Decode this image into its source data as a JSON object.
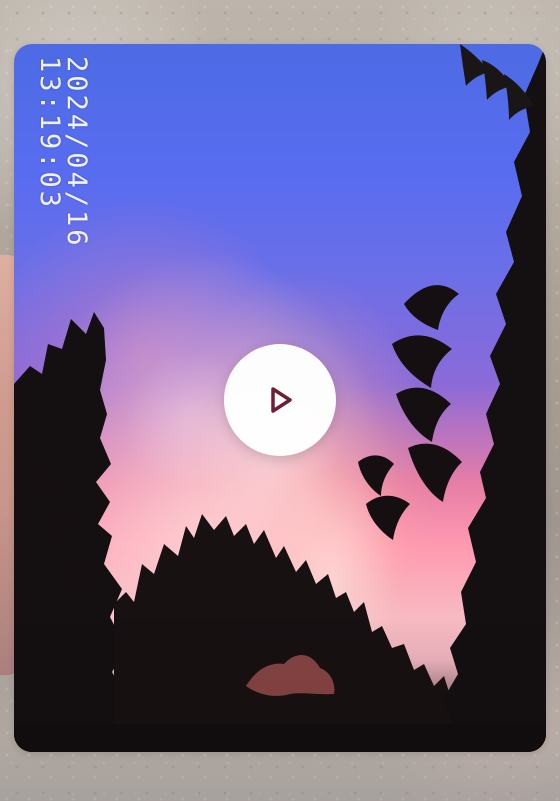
{
  "media": {
    "timestamp": "2024/04/16 13:19:03",
    "play_icon": "play-icon",
    "play_color": "#6f1f33"
  }
}
